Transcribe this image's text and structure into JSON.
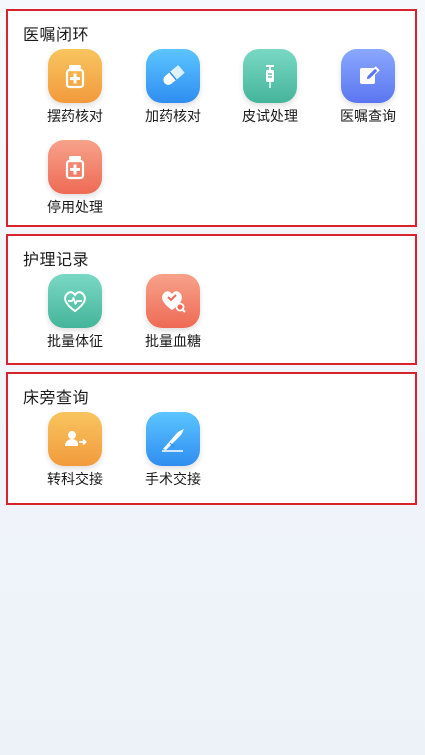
{
  "sections": [
    {
      "title": "医嘱闭环",
      "items": [
        {
          "label": "摆药核对",
          "icon": "medicine-box-icon",
          "color": "#f2a23f"
        },
        {
          "label": "加药核对",
          "icon": "pill-capsule-icon",
          "color": "#3a9cf3"
        },
        {
          "label": "皮试处理",
          "icon": "syringe-icon",
          "color": "#4fbaa0"
        },
        {
          "label": "医嘱查询",
          "icon": "edit-document-icon",
          "color": "#6c86f3"
        },
        {
          "label": "停用处理",
          "icon": "medicine-box-icon",
          "color": "#ef7058"
        }
      ]
    },
    {
      "title": "护理记录",
      "items": [
        {
          "label": "批量体征",
          "icon": "heart-pulse-icon",
          "color": "#4fbaa0"
        },
        {
          "label": "批量血糖",
          "icon": "heart-search-icon",
          "color": "#ef7058"
        }
      ]
    },
    {
      "title": "床旁查询",
      "items": [
        {
          "label": "转科交接",
          "icon": "person-transfer-icon",
          "color": "#f2a23f"
        },
        {
          "label": "手术交接",
          "icon": "scalpel-icon",
          "color": "#3a9cf3"
        }
      ]
    }
  ]
}
